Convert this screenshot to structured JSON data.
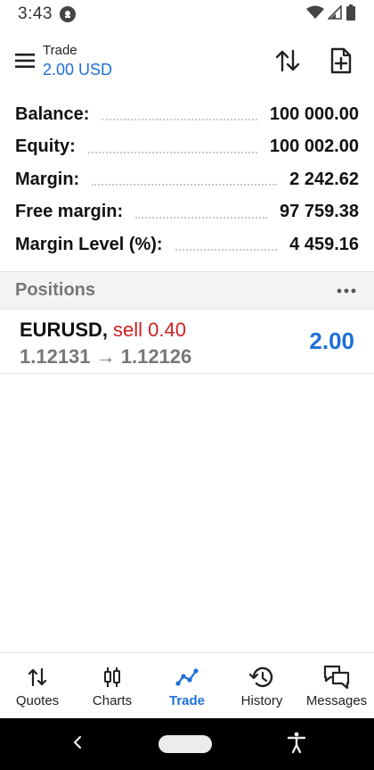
{
  "status": {
    "time": "3:43"
  },
  "header": {
    "title": "Trade",
    "subtitle": "2.00 USD"
  },
  "summary": [
    {
      "label": "Balance:",
      "value": "100 000.00"
    },
    {
      "label": "Equity:",
      "value": "100 002.00"
    },
    {
      "label": "Margin:",
      "value": "2 242.62"
    },
    {
      "label": "Free margin:",
      "value": "97 759.38"
    },
    {
      "label": "Margin Level (%):",
      "value": "4 459.16"
    }
  ],
  "positions": {
    "title": "Positions",
    "items": [
      {
        "symbol": "EURUSD,",
        "side": "sell 0.40",
        "prices": "1.12131 → 1.12126",
        "profit": "2.00"
      }
    ]
  },
  "nav": {
    "items": [
      {
        "label": "Quotes",
        "icon": "quotes-icon"
      },
      {
        "label": "Charts",
        "icon": "charts-icon"
      },
      {
        "label": "Trade",
        "icon": "trade-icon"
      },
      {
        "label": "History",
        "icon": "history-icon"
      },
      {
        "label": "Messages",
        "icon": "messages-icon"
      }
    ],
    "active": "Trade"
  },
  "colors": {
    "accent": "#1e6fd9",
    "sell": "#d11f1f",
    "muted": "#777777"
  }
}
